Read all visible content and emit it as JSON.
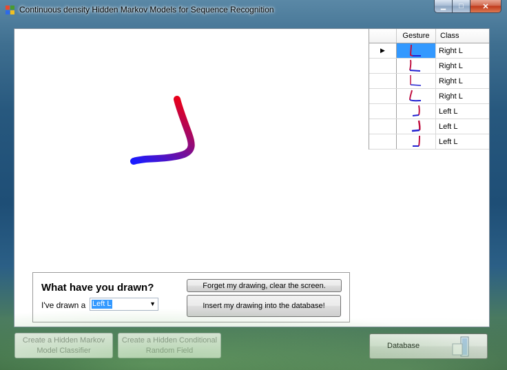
{
  "window": {
    "title": "Continuous density Hidden Markov Models for Sequence Recognition"
  },
  "caption_buttons": {
    "minimize_glyph": "▁",
    "maximize_glyph": "□",
    "close_glyph": "✕"
  },
  "grid": {
    "columns": [
      "Gesture",
      "Class"
    ],
    "current_row_marker": "▶",
    "rows": [
      {
        "class": "Right L",
        "gesture_icon": "right-l-gesture-thumbnail",
        "selected": true
      },
      {
        "class": "Right L",
        "gesture_icon": "right-l-gesture-thumbnail",
        "selected": false
      },
      {
        "class": "Right L",
        "gesture_icon": "right-l-gesture-thumbnail",
        "selected": false
      },
      {
        "class": "Right L",
        "gesture_icon": "right-l-gesture-thumbnail",
        "selected": false
      },
      {
        "class": "Left L",
        "gesture_icon": "left-l-gesture-thumbnail",
        "selected": false
      },
      {
        "class": "Left L",
        "gesture_icon": "left-l-gesture-thumbnail",
        "selected": false
      },
      {
        "class": "Left L",
        "gesture_icon": "left-l-gesture-thumbnail",
        "selected": false
      }
    ]
  },
  "drawing": {
    "stroke_start_color": "#e8001a",
    "stroke_end_color": "#1a1aff"
  },
  "question": {
    "heading": "What have you drawn?",
    "label": "I've drawn a",
    "selected_class": "Left L",
    "dropdown_icon": "chevron-down-icon"
  },
  "buttons": {
    "forget": "Forget my drawing, clear the screen.",
    "insert": "Insert my drawing into the database!",
    "create_hmm": "Create a Hidden Markov Model Classifier",
    "create_hcrf": "Create a Hidden Conditional Random Field",
    "database": "Database"
  },
  "colors": {
    "selection": "#3399ff",
    "close_button": "#c1391b"
  }
}
